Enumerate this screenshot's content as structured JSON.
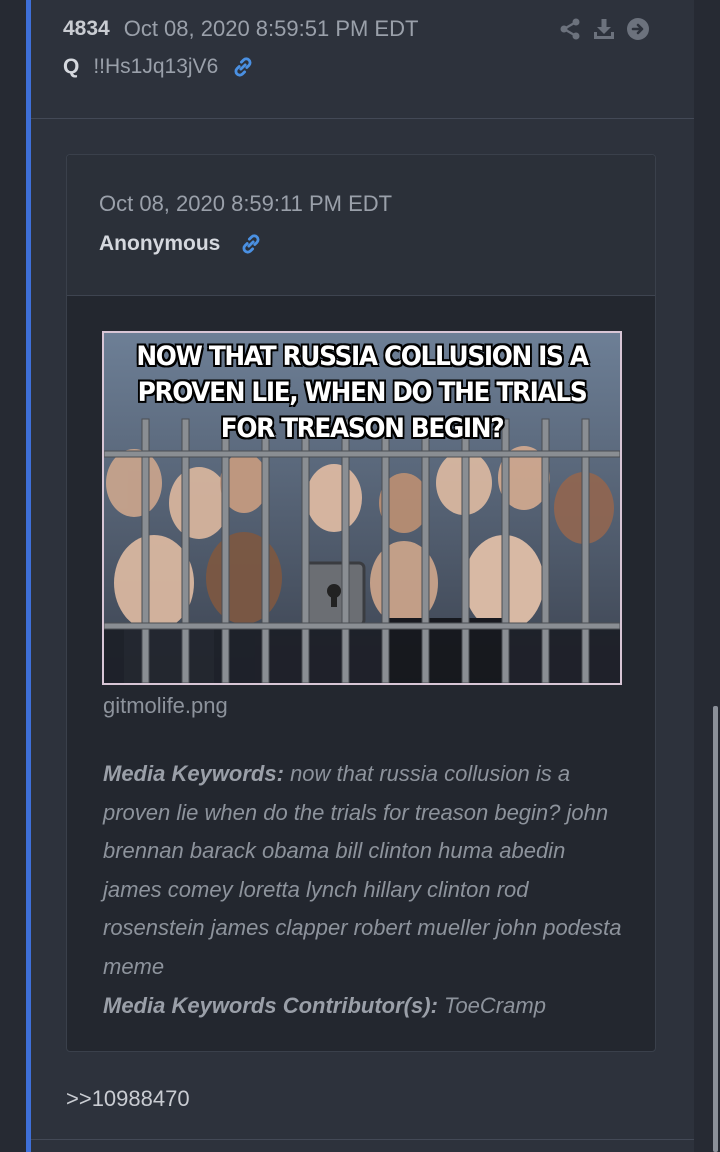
{
  "post": {
    "number": "4834",
    "date": "Oct 08, 2020 8:59:51 PM EDT",
    "author": "Q",
    "tripcode": "!!Hs1Jq13jV6",
    "reply_ref": ">>10988470"
  },
  "quoted_post": {
    "date": "Oct 08, 2020 8:59:11 PM EDT",
    "author": "Anonymous",
    "image": {
      "caption": "NOW THAT RUSSIA COLLUSION IS A PROVEN LIE, WHEN DO THE TRIALS FOR TREASON BEGIN?",
      "caption_lines": [
        "NOW THAT RUSSIA COLLUSION IS A",
        "PROVEN LIE, WHEN DO THE TRIALS",
        "FOR TREASON BEGIN?"
      ]
    },
    "filename": "gitmolife.png",
    "media_keywords_label": "Media Keywords:",
    "media_keywords": "now that russia collusion is a proven lie when do the trials for treason begin? john brennan barack obama bill clinton huma abedin james comey loretta lynch hillary clinton rod rosenstein james clapper robert mueller john podesta meme",
    "contributors_label": "Media Keywords Contributor(s):",
    "contributors": "ToeCramp"
  },
  "icons": {
    "post_actions": [
      "share-icon",
      "download-icon",
      "arrow-right-circle-icon"
    ],
    "permalink": "link-icon"
  },
  "colors": {
    "background": "#2a2f39",
    "accent": "#3e6fd8",
    "link": "#4a90e2"
  }
}
